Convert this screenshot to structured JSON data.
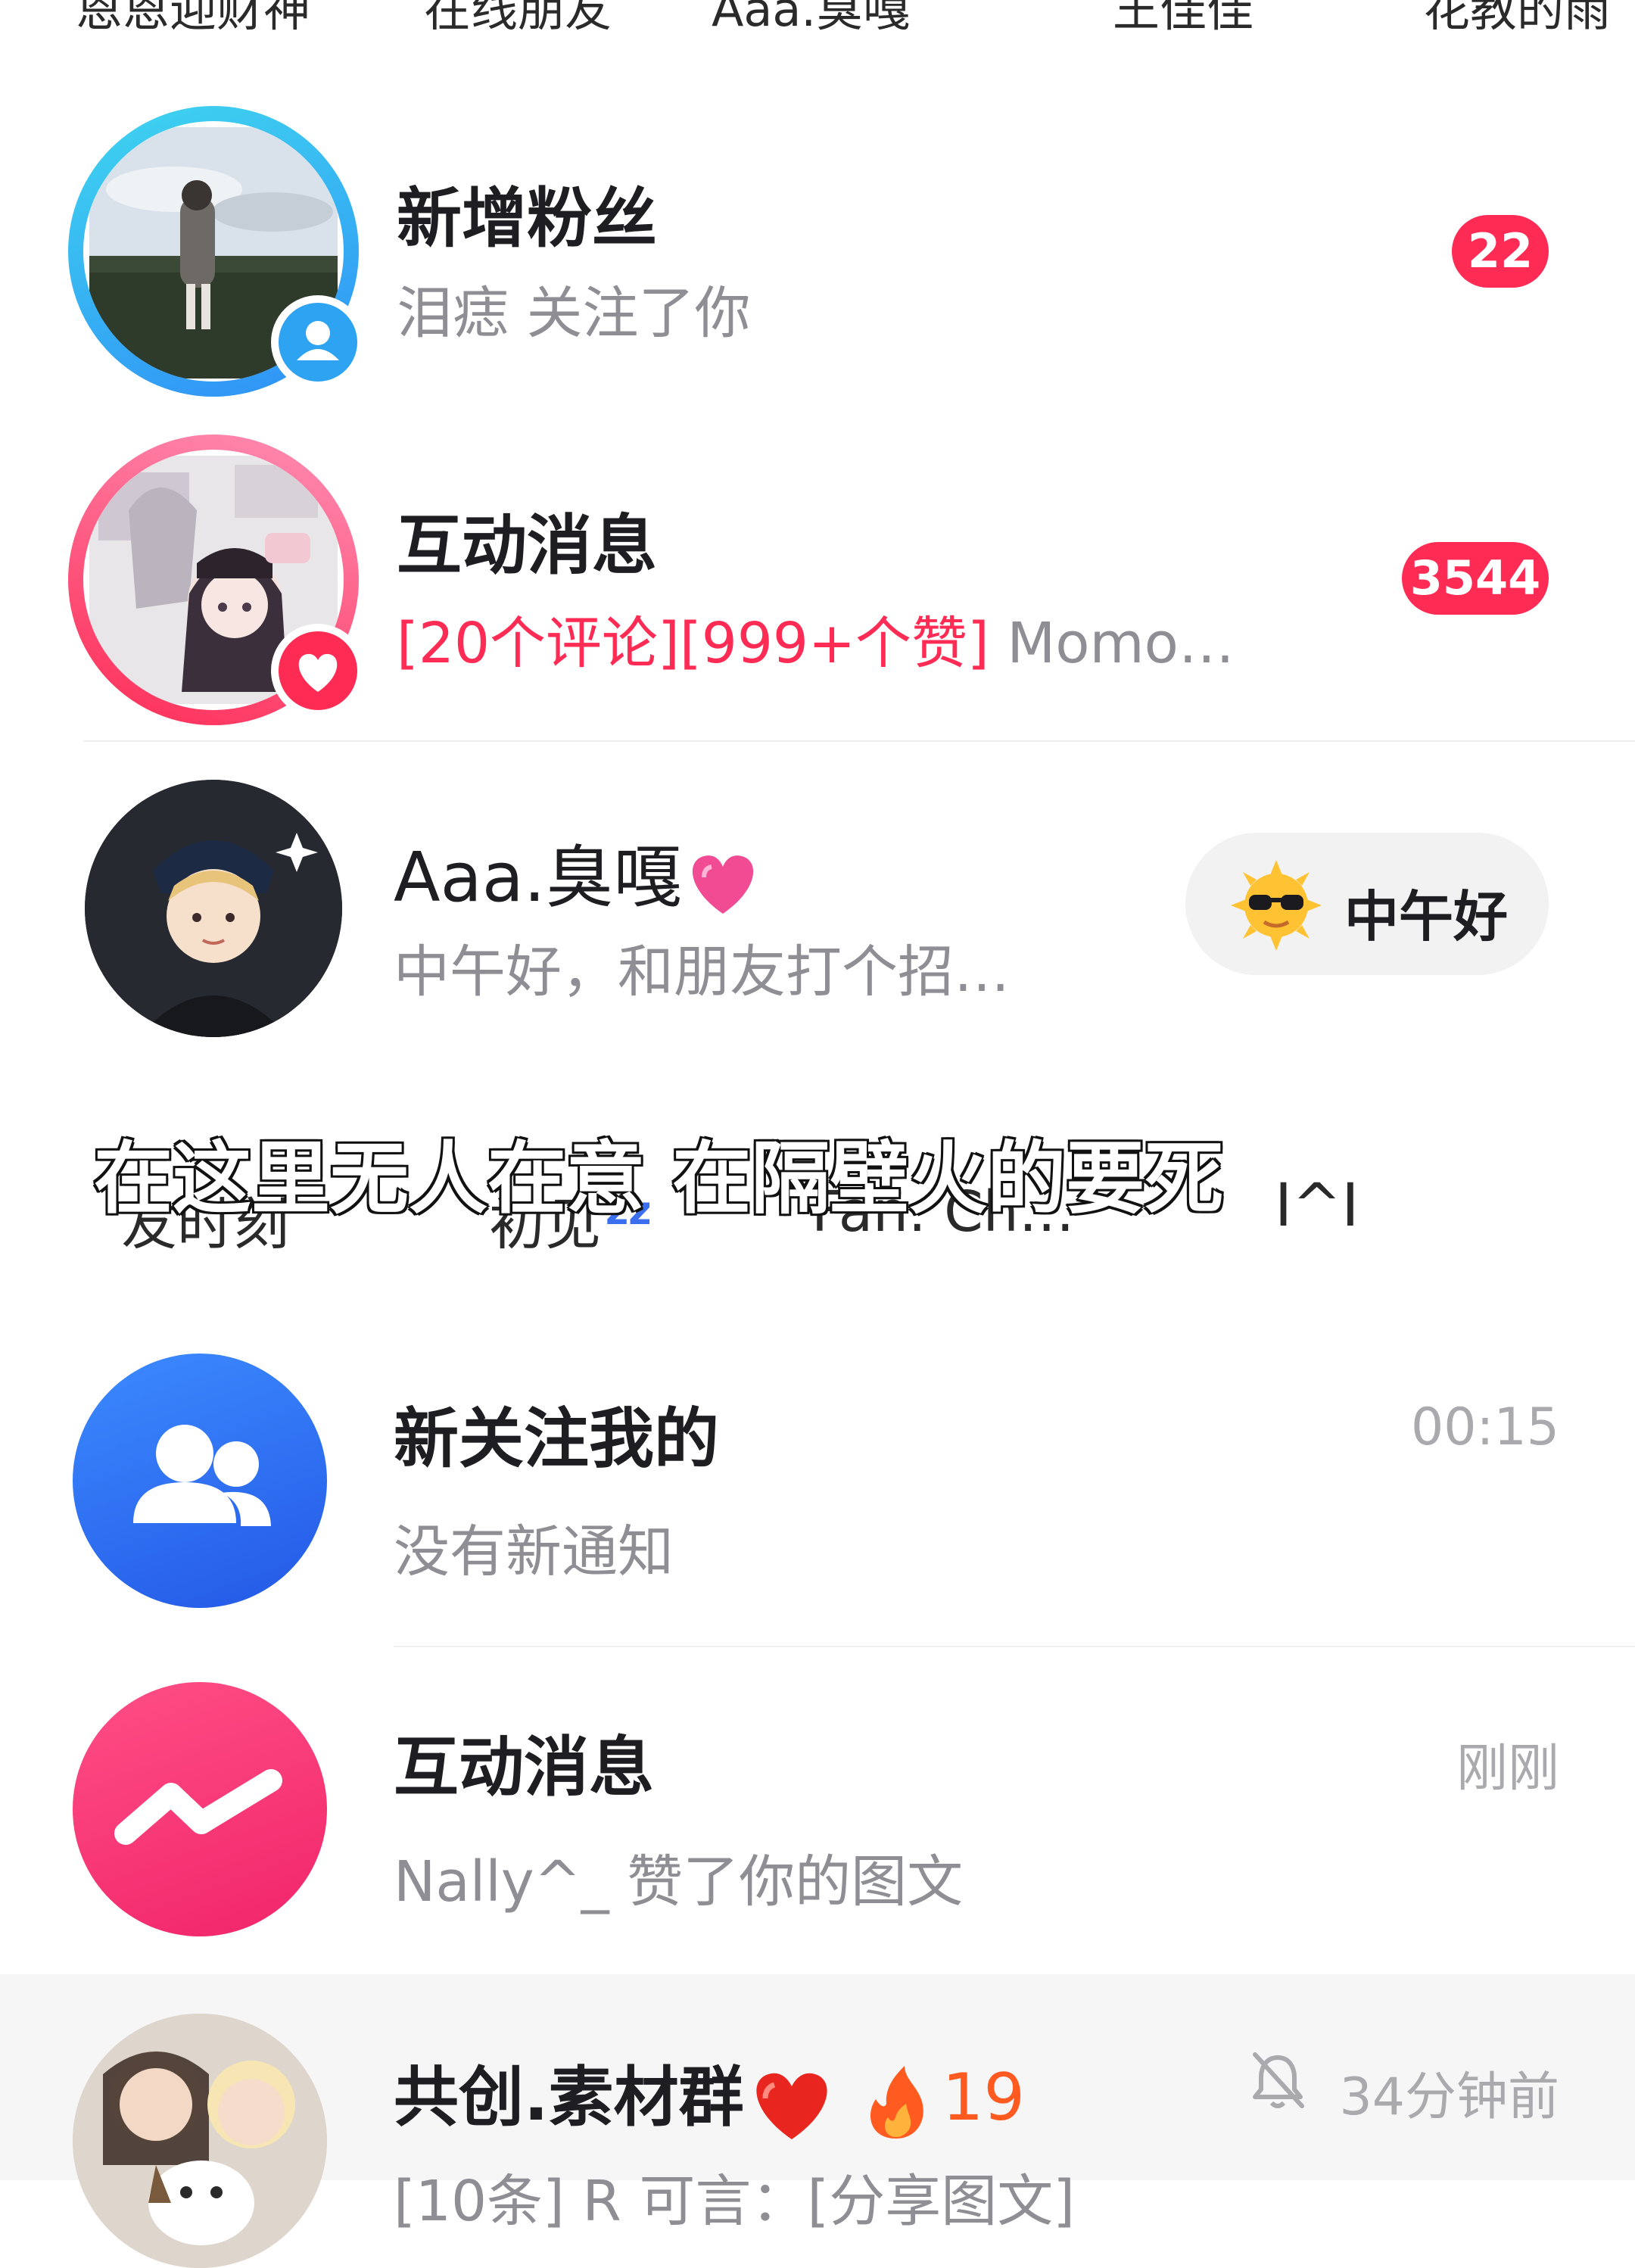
{
  "top_strip": [
    "恩恩迎财神",
    "在线朋友",
    "Aaa.臭嘎",
    "王佳佳",
    "花教的雨"
  ],
  "rows": {
    "new_fans": {
      "title": "新增粉丝",
      "subtitle": "泪痣 关注了你",
      "badge": "22"
    },
    "interaction": {
      "title": "互动消息",
      "subtitle_highlight": "[20个评论][999+个赞]",
      "subtitle_rest": " Momo…",
      "badge": "3544"
    },
    "chat_aaa": {
      "title": "Aaa.臭嘎",
      "subtitle": "中午好，和朋友打个招…",
      "greeting": "中午好"
    },
    "lyric_overlay": {
      "lyric": "在这里无人在意 在隔壁火的要死",
      "behind_1": "友时刻",
      "behind_2": "初见",
      "behind_3": "Fan. Ch…",
      "behind_4": "Ι^Ι"
    },
    "new_follow": {
      "title": "新关注我的",
      "subtitle": "没有新通知",
      "time": "00:15"
    },
    "interaction2": {
      "title": "互动消息",
      "subtitle": "Nally^_ 赞了你的图文",
      "time": "刚刚"
    },
    "group": {
      "title": "共创.素材群",
      "fire_count": "19",
      "time": "34分钟前",
      "subtitle": "[10条] R 可言：[分享图文]"
    }
  },
  "colors": {
    "accent_red": "#fe2c55",
    "blue_icon": "#2f6ff2",
    "gray_text": "#8e8e94"
  },
  "icons": [
    "user-badge-icon",
    "heart-badge-icon",
    "sunglasses-sun-icon",
    "two-users-icon",
    "zigzag-message-icon",
    "heart-emoji-icon",
    "fire-icon",
    "muted-bell-icon",
    "sleep-zz-icon"
  ]
}
